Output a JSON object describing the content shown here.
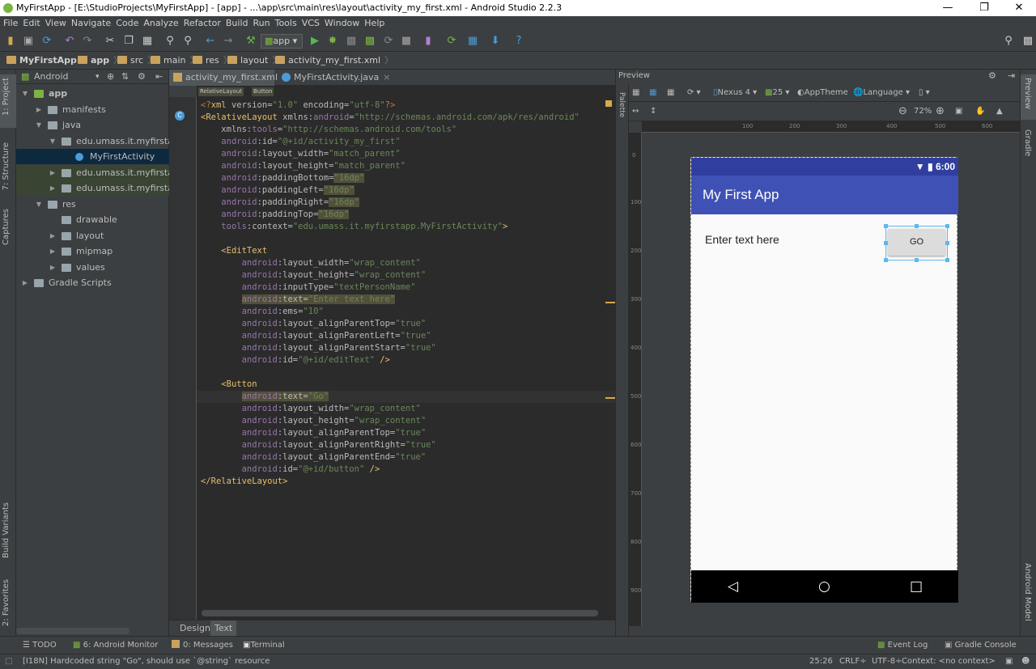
{
  "window": {
    "title": "MyFirstApp - [E:\\StudioProjects\\MyFirstApp] - [app] - ...\\app\\src\\main\\res\\layout\\activity_my_first.xml - Android Studio 2.2.3",
    "minimize": "—",
    "maximize": "❐",
    "close": "✕"
  },
  "menu": [
    "File",
    "Edit",
    "View",
    "Navigate",
    "Code",
    "Analyze",
    "Refactor",
    "Build",
    "Run",
    "Tools",
    "VCS",
    "Window",
    "Help"
  ],
  "toolbar": {
    "run_config": "app"
  },
  "breadcrumb": [
    "MyFirstApp",
    "app",
    "src",
    "main",
    "res",
    "layout",
    "activity_my_first.xml"
  ],
  "left_strip": {
    "project": "1: Project",
    "structure": "7: Structure",
    "captures": "Captures",
    "build_variants": "Build Variants",
    "favorites": "2: Favorites"
  },
  "project_panel": {
    "view_mode": "Android",
    "tree": [
      {
        "label": "app",
        "indent": 0,
        "arrow": "▼",
        "bold": true
      },
      {
        "label": "manifests",
        "indent": 1,
        "arrow": "▶"
      },
      {
        "label": "java",
        "indent": 1,
        "arrow": "▼"
      },
      {
        "label": "edu.umass.it.myfirstapp",
        "indent": 2,
        "arrow": "▼"
      },
      {
        "label": "MyFirstActivity",
        "indent": 3,
        "arrow": "",
        "selected": true
      },
      {
        "label": "edu.umass.it.myfirstapp",
        "indent": 2,
        "arrow": "▶",
        "highlight": true
      },
      {
        "label": "edu.umass.it.myfirstapp",
        "indent": 2,
        "arrow": "▶",
        "highlight": true
      },
      {
        "label": "res",
        "indent": 1,
        "arrow": "▼"
      },
      {
        "label": "drawable",
        "indent": 2,
        "arrow": ""
      },
      {
        "label": "layout",
        "indent": 2,
        "arrow": "▶"
      },
      {
        "label": "mipmap",
        "indent": 2,
        "arrow": "▶"
      },
      {
        "label": "values",
        "indent": 2,
        "arrow": "▶"
      },
      {
        "label": "Gradle Scripts",
        "indent": 0,
        "arrow": "▶"
      }
    ]
  },
  "editor": {
    "tabs": [
      {
        "label": "activity_my_first.xml",
        "close": "×"
      },
      {
        "label": "MyFirstActivity.java",
        "close": "×"
      }
    ],
    "crumb_tags": [
      "RelativeLayout",
      "Button"
    ],
    "bottom_tabs": [
      "Design",
      "Text"
    ]
  },
  "preview": {
    "title": "Preview",
    "palette": "Palette",
    "device": "Nexus 4",
    "api": "25",
    "theme": "AppTheme",
    "language": "Language",
    "zoom": "72%",
    "ruler_h": [
      "100",
      "200",
      "300",
      "400",
      "500",
      "600"
    ],
    "ruler_v": [
      "0",
      "100",
      "200",
      "300",
      "400",
      "500",
      "600",
      "700",
      "800",
      "900"
    ],
    "status_time": "6:00",
    "app_title": "My First App",
    "edit_text": "Enter text here",
    "button_text": "GO",
    "nav_back": "◁",
    "nav_home": "○",
    "nav_recent": "□"
  },
  "right_strip": {
    "preview": "Preview",
    "gradle": "Gradle",
    "android_model": "Android Model"
  },
  "bottom_tools": {
    "todo": "TODO",
    "android_monitor": "6: Android Monitor",
    "messages": "0: Messages",
    "terminal": "Terminal",
    "event_log": "Event Log",
    "gradle_console": "Gradle Console"
  },
  "statusbar": {
    "message": "[I18N] Hardcoded string \"Go\", should use `@string` resource",
    "position": "25:26",
    "line_sep": "CRLF÷",
    "encoding": "UTF-8÷",
    "context": "Context: <no context>"
  },
  "colors": {
    "status_bar": "#303f9f",
    "app_bar": "#3f51b5",
    "ide_bg": "#3c3f41",
    "editor_bg": "#2b2b2b"
  }
}
